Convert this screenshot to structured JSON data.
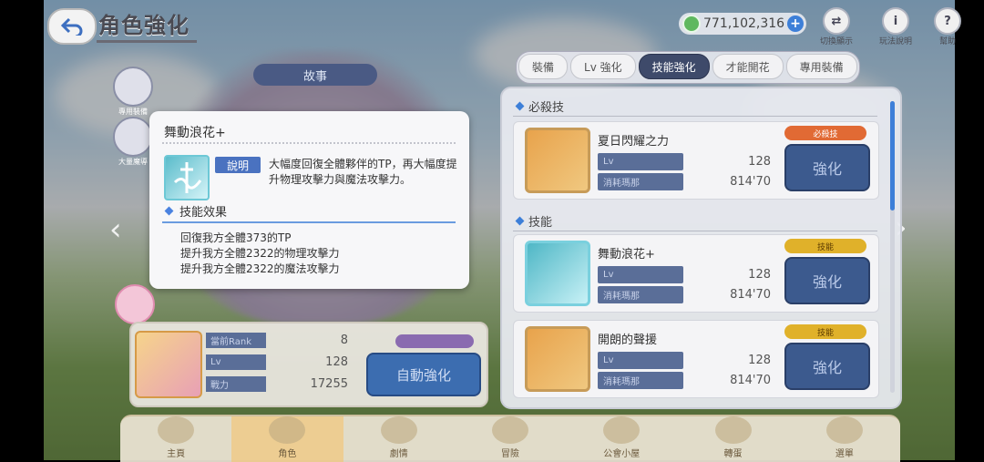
{
  "header": {
    "title": "角色強化",
    "currency_amount": "771,102,316",
    "top_icons": [
      {
        "label": "切換顯示",
        "icon": "display-switch-icon",
        "glyph": "⇄"
      },
      {
        "label": "玩法說明",
        "icon": "info-icon",
        "glyph": "i"
      },
      {
        "label": "幫助",
        "icon": "help-icon",
        "glyph": "?"
      }
    ]
  },
  "tabs": [
    {
      "label": "裝備",
      "active": false
    },
    {
      "label": "Lv 強化",
      "active": false
    },
    {
      "label": "技能強化",
      "active": true
    },
    {
      "label": "才能開花",
      "active": false
    },
    {
      "label": "專用裝備",
      "active": false
    }
  ],
  "stage_label": "故事",
  "side_icons": [
    {
      "label": "專用裝備"
    },
    {
      "label": "大量魔導"
    }
  ],
  "skill_panel": {
    "sections": [
      {
        "title": "必殺技",
        "skills": [
          {
            "name": "夏日閃耀之力",
            "lv_label": "Lv",
            "lv": "128",
            "cost_label": "消耗瑪那",
            "cost": "814'70",
            "badge": "必殺技",
            "button": "強化"
          }
        ]
      },
      {
        "title": "技能",
        "skills": [
          {
            "name": "舞動浪花+",
            "lv_label": "Lv",
            "lv": "128",
            "cost_label": "消耗瑪那",
            "cost": "814'70",
            "badge": "技能",
            "button": "強化"
          },
          {
            "name": "開朗的聲援",
            "lv_label": "Lv",
            "lv": "128",
            "cost_label": "消耗瑪那",
            "cost": "814'70",
            "badge": "技能",
            "button": "強化"
          }
        ]
      }
    ]
  },
  "character": {
    "rank_label": "當前Rank",
    "rank": "8",
    "lv_label": "Lv",
    "lv": "128",
    "power_label": "戰力",
    "power": "17255",
    "auto_button": "自動強化"
  },
  "bottom_nav": [
    {
      "label": "主頁"
    },
    {
      "label": "角色"
    },
    {
      "label": "劇情"
    },
    {
      "label": "冒險"
    },
    {
      "label": "公會小屋"
    },
    {
      "label": "轉蛋"
    },
    {
      "label": "選單"
    }
  ],
  "popup": {
    "title": "舞動浪花+",
    "desc_label": "說明",
    "description": "大幅度回復全體夥伴的TP，再大幅度提升物理攻擊力與魔法攻擊力。",
    "effect_header": "技能效果",
    "effects": [
      "回復我方全體373的TP",
      "提升我方全體2322的物理攻擊力",
      "提升我方全體2322的魔法攻擊力"
    ]
  },
  "colors": {
    "accent_blue": "#3d7fd8",
    "button_blue": "#3c5a8e",
    "badge_red": "#e16a34",
    "badge_yellow": "#e0b12a"
  }
}
